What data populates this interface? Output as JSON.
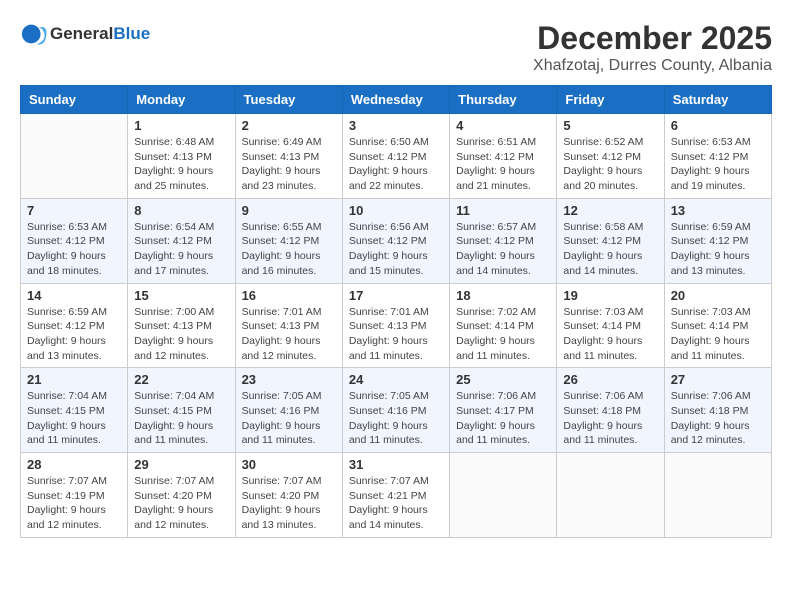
{
  "logo": {
    "text_general": "General",
    "text_blue": "Blue"
  },
  "header": {
    "month": "December 2025",
    "location": "Xhafzotaj, Durres County, Albania"
  },
  "weekdays": [
    "Sunday",
    "Monday",
    "Tuesday",
    "Wednesday",
    "Thursday",
    "Friday",
    "Saturday"
  ],
  "weeks": [
    [
      {
        "day": "",
        "sunrise": "",
        "sunset": "",
        "daylight": ""
      },
      {
        "day": "1",
        "sunrise": "Sunrise: 6:48 AM",
        "sunset": "Sunset: 4:13 PM",
        "daylight": "Daylight: 9 hours and 25 minutes."
      },
      {
        "day": "2",
        "sunrise": "Sunrise: 6:49 AM",
        "sunset": "Sunset: 4:13 PM",
        "daylight": "Daylight: 9 hours and 23 minutes."
      },
      {
        "day": "3",
        "sunrise": "Sunrise: 6:50 AM",
        "sunset": "Sunset: 4:12 PM",
        "daylight": "Daylight: 9 hours and 22 minutes."
      },
      {
        "day": "4",
        "sunrise": "Sunrise: 6:51 AM",
        "sunset": "Sunset: 4:12 PM",
        "daylight": "Daylight: 9 hours and 21 minutes."
      },
      {
        "day": "5",
        "sunrise": "Sunrise: 6:52 AM",
        "sunset": "Sunset: 4:12 PM",
        "daylight": "Daylight: 9 hours and 20 minutes."
      },
      {
        "day": "6",
        "sunrise": "Sunrise: 6:53 AM",
        "sunset": "Sunset: 4:12 PM",
        "daylight": "Daylight: 9 hours and 19 minutes."
      }
    ],
    [
      {
        "day": "7",
        "sunrise": "Sunrise: 6:53 AM",
        "sunset": "Sunset: 4:12 PM",
        "daylight": "Daylight: 9 hours and 18 minutes."
      },
      {
        "day": "8",
        "sunrise": "Sunrise: 6:54 AM",
        "sunset": "Sunset: 4:12 PM",
        "daylight": "Daylight: 9 hours and 17 minutes."
      },
      {
        "day": "9",
        "sunrise": "Sunrise: 6:55 AM",
        "sunset": "Sunset: 4:12 PM",
        "daylight": "Daylight: 9 hours and 16 minutes."
      },
      {
        "day": "10",
        "sunrise": "Sunrise: 6:56 AM",
        "sunset": "Sunset: 4:12 PM",
        "daylight": "Daylight: 9 hours and 15 minutes."
      },
      {
        "day": "11",
        "sunrise": "Sunrise: 6:57 AM",
        "sunset": "Sunset: 4:12 PM",
        "daylight": "Daylight: 9 hours and 14 minutes."
      },
      {
        "day": "12",
        "sunrise": "Sunrise: 6:58 AM",
        "sunset": "Sunset: 4:12 PM",
        "daylight": "Daylight: 9 hours and 14 minutes."
      },
      {
        "day": "13",
        "sunrise": "Sunrise: 6:59 AM",
        "sunset": "Sunset: 4:12 PM",
        "daylight": "Daylight: 9 hours and 13 minutes."
      }
    ],
    [
      {
        "day": "14",
        "sunrise": "Sunrise: 6:59 AM",
        "sunset": "Sunset: 4:12 PM",
        "daylight": "Daylight: 9 hours and 13 minutes."
      },
      {
        "day": "15",
        "sunrise": "Sunrise: 7:00 AM",
        "sunset": "Sunset: 4:13 PM",
        "daylight": "Daylight: 9 hours and 12 minutes."
      },
      {
        "day": "16",
        "sunrise": "Sunrise: 7:01 AM",
        "sunset": "Sunset: 4:13 PM",
        "daylight": "Daylight: 9 hours and 12 minutes."
      },
      {
        "day": "17",
        "sunrise": "Sunrise: 7:01 AM",
        "sunset": "Sunset: 4:13 PM",
        "daylight": "Daylight: 9 hours and 11 minutes."
      },
      {
        "day": "18",
        "sunrise": "Sunrise: 7:02 AM",
        "sunset": "Sunset: 4:14 PM",
        "daylight": "Daylight: 9 hours and 11 minutes."
      },
      {
        "day": "19",
        "sunrise": "Sunrise: 7:03 AM",
        "sunset": "Sunset: 4:14 PM",
        "daylight": "Daylight: 9 hours and 11 minutes."
      },
      {
        "day": "20",
        "sunrise": "Sunrise: 7:03 AM",
        "sunset": "Sunset: 4:14 PM",
        "daylight": "Daylight: 9 hours and 11 minutes."
      }
    ],
    [
      {
        "day": "21",
        "sunrise": "Sunrise: 7:04 AM",
        "sunset": "Sunset: 4:15 PM",
        "daylight": "Daylight: 9 hours and 11 minutes."
      },
      {
        "day": "22",
        "sunrise": "Sunrise: 7:04 AM",
        "sunset": "Sunset: 4:15 PM",
        "daylight": "Daylight: 9 hours and 11 minutes."
      },
      {
        "day": "23",
        "sunrise": "Sunrise: 7:05 AM",
        "sunset": "Sunset: 4:16 PM",
        "daylight": "Daylight: 9 hours and 11 minutes."
      },
      {
        "day": "24",
        "sunrise": "Sunrise: 7:05 AM",
        "sunset": "Sunset: 4:16 PM",
        "daylight": "Daylight: 9 hours and 11 minutes."
      },
      {
        "day": "25",
        "sunrise": "Sunrise: 7:06 AM",
        "sunset": "Sunset: 4:17 PM",
        "daylight": "Daylight: 9 hours and 11 minutes."
      },
      {
        "day": "26",
        "sunrise": "Sunrise: 7:06 AM",
        "sunset": "Sunset: 4:18 PM",
        "daylight": "Daylight: 9 hours and 11 minutes."
      },
      {
        "day": "27",
        "sunrise": "Sunrise: 7:06 AM",
        "sunset": "Sunset: 4:18 PM",
        "daylight": "Daylight: 9 hours and 12 minutes."
      }
    ],
    [
      {
        "day": "28",
        "sunrise": "Sunrise: 7:07 AM",
        "sunset": "Sunset: 4:19 PM",
        "daylight": "Daylight: 9 hours and 12 minutes."
      },
      {
        "day": "29",
        "sunrise": "Sunrise: 7:07 AM",
        "sunset": "Sunset: 4:20 PM",
        "daylight": "Daylight: 9 hours and 12 minutes."
      },
      {
        "day": "30",
        "sunrise": "Sunrise: 7:07 AM",
        "sunset": "Sunset: 4:20 PM",
        "daylight": "Daylight: 9 hours and 13 minutes."
      },
      {
        "day": "31",
        "sunrise": "Sunrise: 7:07 AM",
        "sunset": "Sunset: 4:21 PM",
        "daylight": "Daylight: 9 hours and 14 minutes."
      },
      {
        "day": "",
        "sunrise": "",
        "sunset": "",
        "daylight": ""
      },
      {
        "day": "",
        "sunrise": "",
        "sunset": "",
        "daylight": ""
      },
      {
        "day": "",
        "sunrise": "",
        "sunset": "",
        "daylight": ""
      }
    ]
  ]
}
